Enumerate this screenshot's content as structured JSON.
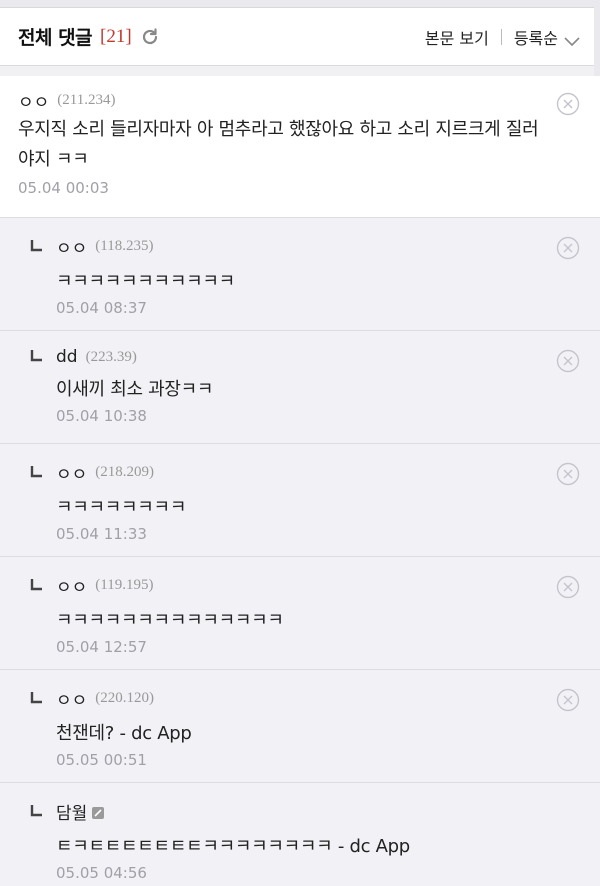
{
  "header": {
    "title": "전체 댓글",
    "count": "[21]",
    "view_post_label": "본문 보기",
    "sort_label": "등록순"
  },
  "comments": [
    {
      "nick": "ㅇㅇ",
      "ip": "(211.234)",
      "text": "우지직 소리 들리자마자 아 멈추라고 했잖아요 하고 소리 지르크게 질러야지 ㅋㅋ",
      "date": "05.04 00:03"
    },
    {
      "nick": "ㅇㅇ",
      "ip": "(118.235)",
      "text": "ㅋㅋㅋㅋㅋㅋㅋㅋㅋㅋㅋ",
      "date": "05.04 08:37"
    },
    {
      "nick": "dd",
      "ip": "(223.39)",
      "text": "이새끼 최소 과장ㅋㅋ",
      "date": "05.04 10:38"
    },
    {
      "nick": "ㅇㅇ",
      "ip": "(218.209)",
      "text": "ㅋㅋㅋㅋㅋㅋㅋㅋ",
      "date": "05.04 11:33"
    },
    {
      "nick": "ㅇㅇ",
      "ip": "(119.195)",
      "text": "ㅋㅋㅋㅋㅋㅋㅋㅋㅋㅋㅋㅋㅋㅋ",
      "date": "05.04 12:57"
    },
    {
      "nick": "ㅇㅇ",
      "ip": "(220.120)",
      "text": "천잰데? - dc App",
      "date": "05.05 00:51"
    },
    {
      "nick": "담월",
      "ip": "",
      "text": "ㅌㅋㅌㅌㅌㅌㅌㅌㅌㅋㅋㅋㅋㅋㅋㅋㅋ - dc App",
      "date": "05.05 04:56"
    }
  ],
  "colors": {
    "accent_count": "#c0392b",
    "reply_bg": "#f2f2f6",
    "muted_text": "#a0a0a8"
  },
  "icons": {
    "refresh": "refresh-icon",
    "chevron": "chevron-down-icon",
    "delete": "close-icon",
    "reply": "reply-arrow-icon",
    "fixed_nick": "fixed-nick-icon"
  }
}
